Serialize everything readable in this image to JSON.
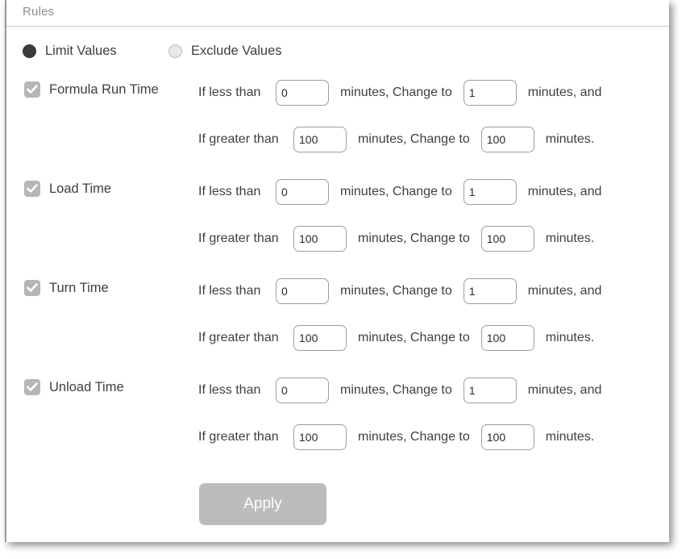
{
  "panel": {
    "title": "Rules",
    "colors": {
      "text": "#3c4043",
      "title": "#8a8f94",
      "checkbox_fill": "#b6b6b6",
      "radio_on": "#3b3b3b",
      "radio_off": "#e8e8e8",
      "apply_bg": "#bcbcbc",
      "border": "#9e9e9e"
    }
  },
  "mode": {
    "options": [
      {
        "label": "Limit Values",
        "selected": true
      },
      {
        "label": "Exclude Values",
        "selected": false
      }
    ]
  },
  "labels": {
    "if_less_than": "If less than",
    "if_greater_than": "If greater than",
    "minutes_change_to": "minutes, Change to",
    "minutes_and": "minutes, and",
    "minutes_period": "minutes."
  },
  "rules": [
    {
      "name": "Formula Run Time",
      "checked": true,
      "less_than": {
        "threshold": "0",
        "change_to": "1"
      },
      "greater_than": {
        "threshold": "100",
        "change_to": "100"
      }
    },
    {
      "name": "Load Time",
      "checked": true,
      "less_than": {
        "threshold": "0",
        "change_to": "1"
      },
      "greater_than": {
        "threshold": "100",
        "change_to": "100"
      }
    },
    {
      "name": "Turn Time",
      "checked": true,
      "less_than": {
        "threshold": "0",
        "change_to": "1"
      },
      "greater_than": {
        "threshold": "100",
        "change_to": "100"
      }
    },
    {
      "name": "Unload Time",
      "checked": true,
      "less_than": {
        "threshold": "0",
        "change_to": "1"
      },
      "greater_than": {
        "threshold": "100",
        "change_to": "100"
      }
    }
  ],
  "apply": {
    "label": "Apply",
    "enabled": false
  }
}
